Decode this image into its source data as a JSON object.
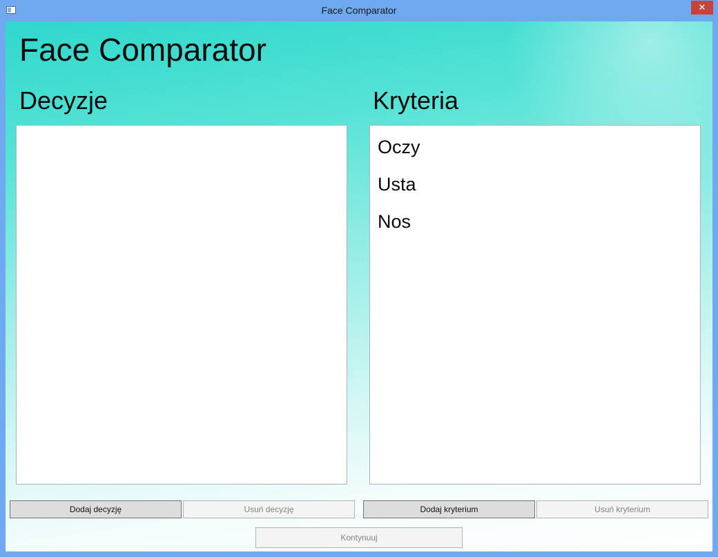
{
  "window": {
    "title": "Face Comparator",
    "close_glyph": "✕"
  },
  "header": {
    "title": "Face Comparator"
  },
  "decisions": {
    "title": "Decyzje",
    "items": []
  },
  "criteria": {
    "title": "Kryteria",
    "items": [
      "Oczy",
      "Usta",
      "Nos"
    ]
  },
  "buttons": {
    "add_decision": "Dodaj decyzję",
    "remove_decision": "Usuń decyzję",
    "add_criterion": "Dodaj kryterium",
    "remove_criterion": "Usuń kryterium",
    "continue": "Kontynuuj"
  }
}
